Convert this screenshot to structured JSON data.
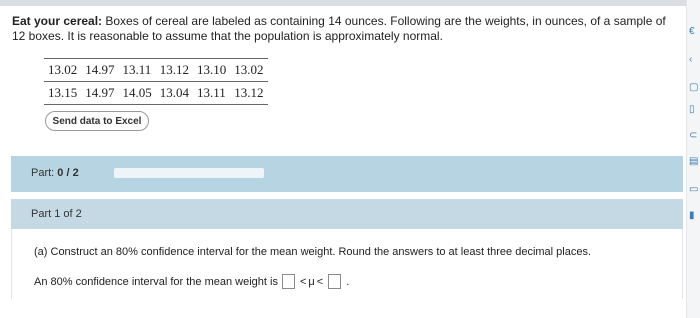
{
  "problem": {
    "lead": "Eat your cereal:",
    "text": " Boxes of cereal are labeled as containing 14 ounces. Following are the weights, in ounces, of a sample of 12 boxes. It is reasonable to assume that the population is approximately normal."
  },
  "data_table": {
    "rows": [
      [
        "13.02",
        "14.97",
        "13.11",
        "13.12",
        "13.10",
        "13.02"
      ],
      [
        "13.15",
        "14.97",
        "14.05",
        "13.04",
        "13.11",
        "13.12"
      ]
    ]
  },
  "excel_button": {
    "label": "Send data to Excel"
  },
  "part_progress": {
    "label": "Part:",
    "value": "0 / 2",
    "completed": 0,
    "total": 2,
    "fill_color": "#2f8fd8"
  },
  "part1": {
    "header": "Part 1 of 2",
    "question": "(a) Construct an 80% confidence interval for the mean weight. Round the answers to at least three decimal places.",
    "answer_prefix": "An 80% confidence interval for the mean weight is",
    "lower_value": "",
    "less_than_1": "<",
    "mu": "μ",
    "less_than_2": "<",
    "upper_value": "",
    "period": "."
  },
  "right_toolbar": {
    "icons": [
      "expand-icon",
      "chevron-left-icon",
      "grid-icon",
      "book-icon",
      "help-icon",
      "calculator-icon",
      "document-icon",
      "panel-icon"
    ]
  },
  "colors": {
    "part_bar": "#b7d4e2",
    "part1_header": "#c5d9e4",
    "accent": "#2f8fd8"
  }
}
